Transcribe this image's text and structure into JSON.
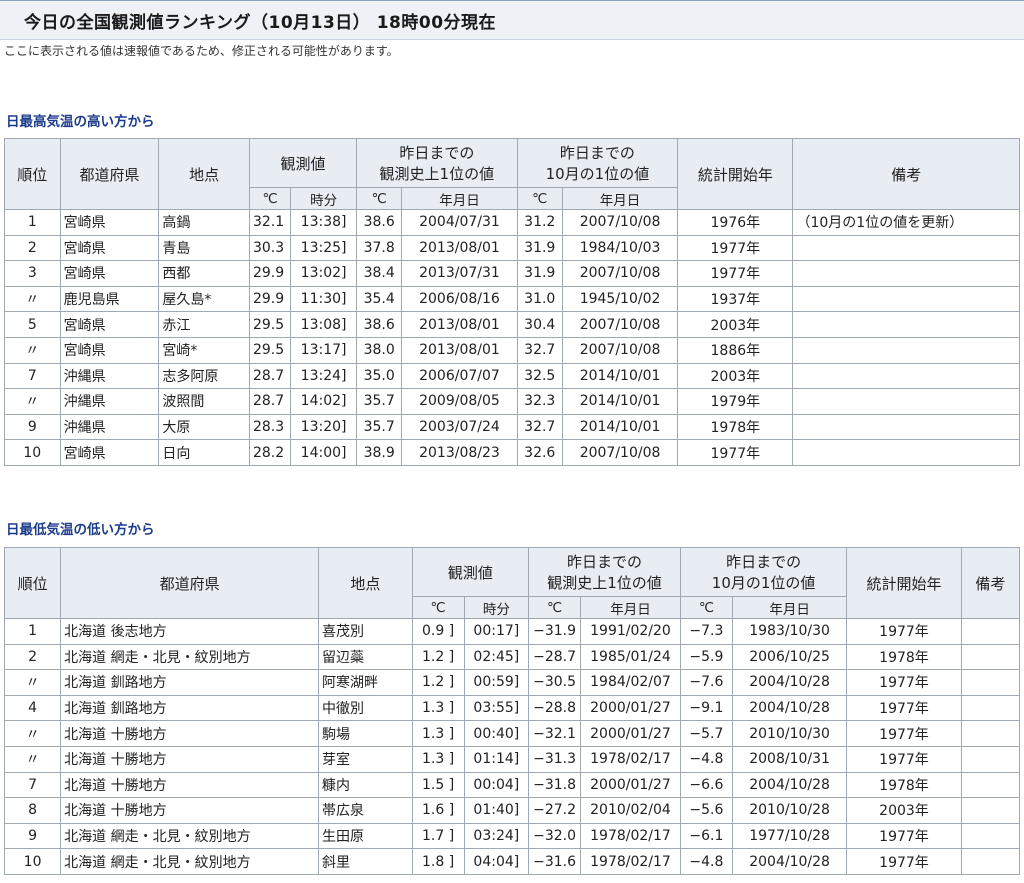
{
  "page_title": "今日の全国観測値ランキング（10月13日） 18時00分現在",
  "notice": "ここに表示される値は速報値であるため、修正される可能性があります。",
  "high": {
    "section_title": "日最高気温の高い方から",
    "headers": {
      "rank": "順位",
      "prefecture": "都道府県",
      "site": "地点",
      "observed": "観測値",
      "record_all": "昨日までの\n観測史上1位の値",
      "record_oct": "昨日までの\n10月の1位の値",
      "start_year": "統計開始年",
      "remarks": "備考",
      "unit_c": "℃",
      "unit_time": "時分",
      "unit_date": "年月日"
    },
    "rows": [
      {
        "rank": "1",
        "pref": "宮崎県",
        "site": "高鍋",
        "val": "32.1 ]",
        "time": "13:38]",
        "rec_val": "38.6",
        "rec_date": "2004/07/31",
        "oct_val": "31.2",
        "oct_date": "2007/10/08",
        "start": "1976年",
        "remark": "（10月の1位の値を更新）"
      },
      {
        "rank": "2",
        "pref": "宮崎県",
        "site": "青島",
        "val": "30.3 ]",
        "time": "13:25]",
        "rec_val": "37.8",
        "rec_date": "2013/08/01",
        "oct_val": "31.9",
        "oct_date": "1984/10/03",
        "start": "1977年",
        "remark": ""
      },
      {
        "rank": "3",
        "pref": "宮崎県",
        "site": "西都",
        "val": "29.9 ]",
        "time": "13:02]",
        "rec_val": "38.4",
        "rec_date": "2013/07/31",
        "oct_val": "31.9",
        "oct_date": "2007/10/08",
        "start": "1977年",
        "remark": ""
      },
      {
        "rank": "〃",
        "pref": "鹿児島県",
        "site": "屋久島*",
        "val": "29.9 ]",
        "time": "11:30]",
        "rec_val": "35.4",
        "rec_date": "2006/08/16",
        "oct_val": "31.0",
        "oct_date": "1945/10/02",
        "start": "1937年",
        "remark": ""
      },
      {
        "rank": "5",
        "pref": "宮崎県",
        "site": "赤江",
        "val": "29.5 ]",
        "time": "13:08]",
        "rec_val": "38.6",
        "rec_date": "2013/08/01",
        "oct_val": "30.4",
        "oct_date": "2007/10/08",
        "start": "2003年",
        "remark": ""
      },
      {
        "rank": "〃",
        "pref": "宮崎県",
        "site": "宮崎*",
        "val": "29.5 ]",
        "time": "13:17]",
        "rec_val": "38.0",
        "rec_date": "2013/08/01",
        "oct_val": "32.7",
        "oct_date": "2007/10/08",
        "start": "1886年",
        "remark": ""
      },
      {
        "rank": "7",
        "pref": "沖縄県",
        "site": "志多阿原",
        "val": "28.7 ]",
        "time": "13:24]",
        "rec_val": "35.0",
        "rec_date": "2006/07/07",
        "oct_val": "32.5",
        "oct_date": "2014/10/01",
        "start": "2003年",
        "remark": ""
      },
      {
        "rank": "〃",
        "pref": "沖縄県",
        "site": "波照間",
        "val": "28.7 ]",
        "time": "14:02]",
        "rec_val": "35.7",
        "rec_date": "2009/08/05",
        "oct_val": "32.3",
        "oct_date": "2014/10/01",
        "start": "1979年",
        "remark": ""
      },
      {
        "rank": "9",
        "pref": "沖縄県",
        "site": "大原",
        "val": "28.3 ]",
        "time": "13:20]",
        "rec_val": "35.7",
        "rec_date": "2003/07/24",
        "oct_val": "32.7",
        "oct_date": "2014/10/01",
        "start": "1978年",
        "remark": ""
      },
      {
        "rank": "10",
        "pref": "宮崎県",
        "site": "日向",
        "val": "28.2 ]",
        "time": "14:00]",
        "rec_val": "38.9",
        "rec_date": "2013/08/23",
        "oct_val": "32.6",
        "oct_date": "2007/10/08",
        "start": "1977年",
        "remark": ""
      }
    ]
  },
  "low": {
    "section_title": "日最低気温の低い方から",
    "headers": {
      "rank": "順位",
      "prefecture": "都道府県",
      "site": "地点",
      "observed": "観測値",
      "record_all": "昨日までの\n観測史上1位の値",
      "record_oct": "昨日までの\n10月の1位の値",
      "start_year": "統計開始年",
      "remarks": "備考",
      "unit_c": "℃",
      "unit_time": "時分",
      "unit_date": "年月日"
    },
    "rows": [
      {
        "rank": "1",
        "pref": "北海道 後志地方",
        "site": "喜茂別",
        "val": "0.9 ]",
        "time": "00:17]",
        "rec_val": "−31.9",
        "rec_date": "1991/02/20",
        "oct_val": "−7.3",
        "oct_date": "1983/10/30",
        "start": "1977年",
        "remark": ""
      },
      {
        "rank": "2",
        "pref": "北海道 網走・北見・紋別地方",
        "site": "留辺蘂",
        "val": "1.2 ]",
        "time": "02:45]",
        "rec_val": "−28.7",
        "rec_date": "1985/01/24",
        "oct_val": "−5.9",
        "oct_date": "2006/10/25",
        "start": "1978年",
        "remark": ""
      },
      {
        "rank": "〃",
        "pref": "北海道 釧路地方",
        "site": "阿寒湖畔",
        "val": "1.2 ]",
        "time": "00:59]",
        "rec_val": "−30.5",
        "rec_date": "1984/02/07",
        "oct_val": "−7.6",
        "oct_date": "2004/10/28",
        "start": "1977年",
        "remark": ""
      },
      {
        "rank": "4",
        "pref": "北海道 釧路地方",
        "site": "中徹別",
        "val": "1.3 ]",
        "time": "03:55]",
        "rec_val": "−28.8",
        "rec_date": "2000/01/27",
        "oct_val": "−9.1",
        "oct_date": "2004/10/28",
        "start": "1977年",
        "remark": ""
      },
      {
        "rank": "〃",
        "pref": "北海道 十勝地方",
        "site": "駒場",
        "val": "1.3 ]",
        "time": "00:40]",
        "rec_val": "−32.1",
        "rec_date": "2000/01/27",
        "oct_val": "−5.7",
        "oct_date": "2010/10/30",
        "start": "1977年",
        "remark": ""
      },
      {
        "rank": "〃",
        "pref": "北海道 十勝地方",
        "site": "芽室",
        "val": "1.3 ]",
        "time": "01:14]",
        "rec_val": "−31.3",
        "rec_date": "1978/02/17",
        "oct_val": "−4.8",
        "oct_date": "2008/10/31",
        "start": "1977年",
        "remark": ""
      },
      {
        "rank": "7",
        "pref": "北海道 十勝地方",
        "site": "糠内",
        "val": "1.5 ]",
        "time": "00:04]",
        "rec_val": "−31.8",
        "rec_date": "2000/01/27",
        "oct_val": "−6.6",
        "oct_date": "2004/10/28",
        "start": "1978年",
        "remark": ""
      },
      {
        "rank": "8",
        "pref": "北海道 十勝地方",
        "site": "帯広泉",
        "val": "1.6 ]",
        "time": "01:40]",
        "rec_val": "−27.2",
        "rec_date": "2010/02/04",
        "oct_val": "−5.6",
        "oct_date": "2010/10/28",
        "start": "2003年",
        "remark": ""
      },
      {
        "rank": "9",
        "pref": "北海道 網走・北見・紋別地方",
        "site": "生田原",
        "val": "1.7 ]",
        "time": "03:24]",
        "rec_val": "−32.0",
        "rec_date": "1978/02/17",
        "oct_val": "−6.1",
        "oct_date": "1977/10/28",
        "start": "1977年",
        "remark": ""
      },
      {
        "rank": "10",
        "pref": "北海道 網走・北見・紋別地方",
        "site": "斜里",
        "val": "1.8 ]",
        "time": "04:04]",
        "rec_val": "−31.6",
        "rec_date": "1978/02/17",
        "oct_val": "−4.8",
        "oct_date": "2004/10/28",
        "start": "1977年",
        "remark": ""
      }
    ]
  }
}
